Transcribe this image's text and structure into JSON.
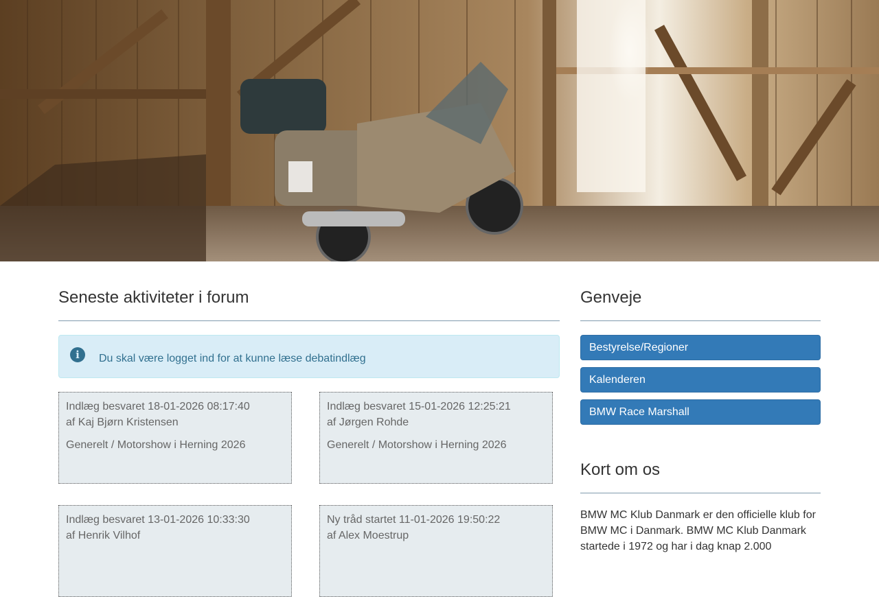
{
  "hero": {
    "alt": "",
    "colors": {
      "wood": "#8a6a45",
      "light": "#ffffff"
    }
  },
  "forum": {
    "title": "Seneste aktiviteter i forum",
    "alert": {
      "icon": "info-icon",
      "text": "Du skal være logget ind for at kunne læse debatindlæg"
    },
    "posts": [
      {
        "line1": "Indlæg besvaret 18-01-2026 08:17:40",
        "line2": "af Kaj Bjørn Kristensen",
        "line3": "Generelt / Motorshow i Herning 2026"
      },
      {
        "line1": "Indlæg besvaret 15-01-2026 12:25:21",
        "line2": "af Jørgen Rohde",
        "line3": "Generelt / Motorshow i Herning 2026"
      },
      {
        "line1": "Indlæg besvaret 13-01-2026 10:33:30",
        "line2": "af Henrik Vilhof",
        "line3": ""
      },
      {
        "line1": "Ny tråd startet 11-01-2026 19:50:22",
        "line2": "af Alex Moestrup",
        "line3": ""
      }
    ]
  },
  "shortcuts": {
    "title": "Genveje",
    "items": [
      {
        "label": "Bestyrelse/Regioner"
      },
      {
        "label": "Kalenderen"
      },
      {
        "label": "BMW Race Marshall"
      }
    ]
  },
  "about": {
    "title": "Kort om os",
    "text": "BMW MC Klub Danmark er den officielle klub for BMW MC i Danmark. BMW MC Klub Danmark startede i 1972 og har i dag knap 2.000"
  },
  "colors": {
    "accent": "#337ab7",
    "alert_bg": "#d9edf7",
    "alert_text": "#31708f",
    "card_bg": "#e6ecef",
    "divider": "#7f99ad"
  }
}
